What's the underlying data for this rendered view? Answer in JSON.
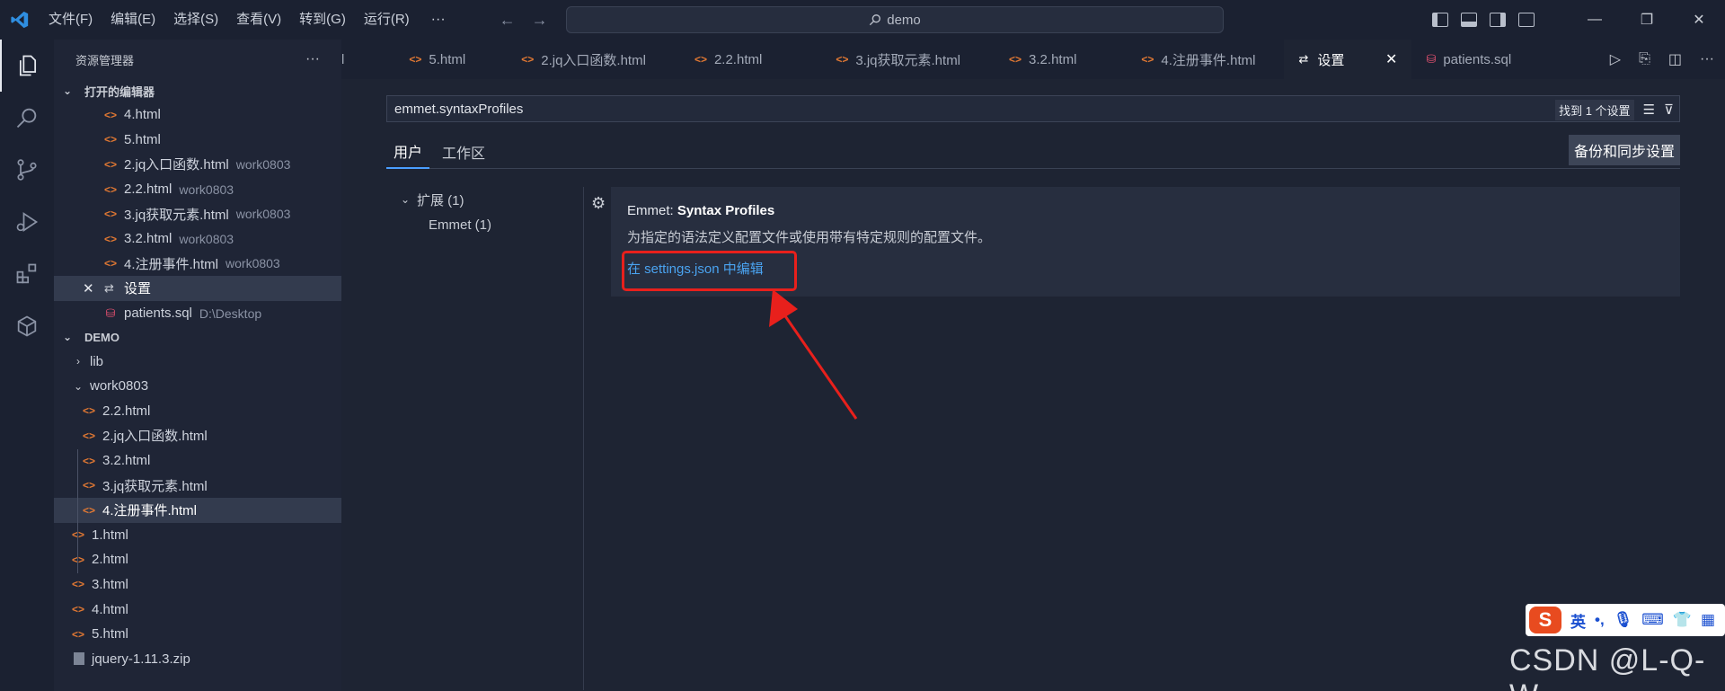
{
  "menu": {
    "file": "文件(F)",
    "edit": "编辑(E)",
    "select": "选择(S)",
    "view": "查看(V)",
    "goto": "转到(G)",
    "run": "运行(R)",
    "more": "···"
  },
  "search": {
    "text": "demo"
  },
  "sidebar": {
    "title": "资源管理器",
    "more": "···",
    "open_editors_title": "打开的编辑器",
    "open_editors": [
      {
        "name": "4.html",
        "desc": ""
      },
      {
        "name": "5.html",
        "desc": ""
      },
      {
        "name": "2.jq入口函数.html",
        "desc": "work0803"
      },
      {
        "name": "2.2.html",
        "desc": "work0803"
      },
      {
        "name": "3.jq获取元素.html",
        "desc": "work0803"
      },
      {
        "name": "3.2.html",
        "desc": "work0803"
      },
      {
        "name": "4.注册事件.html",
        "desc": "work0803"
      },
      {
        "name": "设置",
        "desc": ""
      },
      {
        "name": "patients.sql",
        "desc": "D:\\Desktop"
      }
    ],
    "demo_title": "DEMO",
    "tree": {
      "lib": "lib",
      "work0803": "work0803",
      "work_files": [
        "2.2.html",
        "2.jq入口函数.html",
        "3.2.html",
        "3.jq获取元素.html",
        "4.注册事件.html"
      ],
      "root_files": [
        "1.html",
        "2.html",
        "3.html",
        "4.html",
        "5.html"
      ],
      "zip": "jquery-1.11.3.zip"
    }
  },
  "tabs": [
    {
      "label": "l"
    },
    {
      "label": "5.html"
    },
    {
      "label": "2.jq入口函数.html"
    },
    {
      "label": "2.2.html"
    },
    {
      "label": "3.jq获取元素.html"
    },
    {
      "label": "3.2.html"
    },
    {
      "label": "4.注册事件.html"
    },
    {
      "label": "设置"
    },
    {
      "label": "patients.sql"
    }
  ],
  "settings": {
    "query": "emmet.syntaxProfiles",
    "found": "找到 1 个设置",
    "tab_user": "用户",
    "tab_workspace": "工作区",
    "backup_button": "备份和同步设置",
    "toc_extensions": "扩展 (1)",
    "toc_emmet": "Emmet (1)",
    "item_prefix": "Emmet: ",
    "item_title": "Syntax Profiles",
    "item_desc": "为指定的语法定义配置文件或使用带有特定规则的配置文件。",
    "item_link": "在 settings.json 中编辑"
  },
  "ime": {
    "lang": "英"
  },
  "watermark": "CSDN @L-Q-W",
  "colors": {
    "accent": "#4a9eff",
    "annotation_red": "#e8201c",
    "file_icon": "#e37933"
  }
}
